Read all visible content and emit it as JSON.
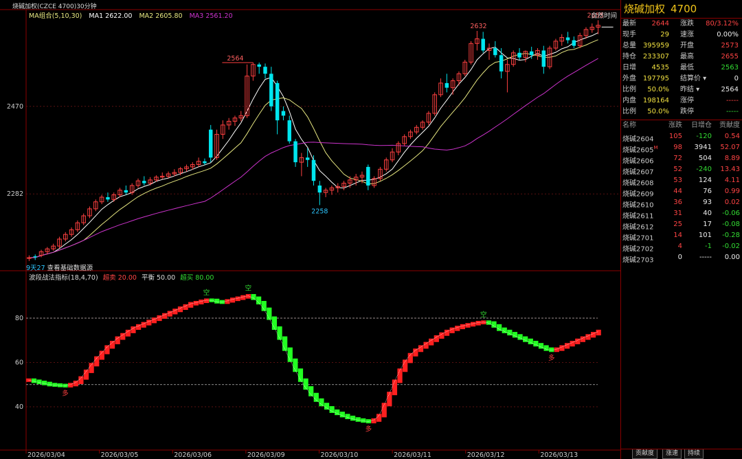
{
  "chart": {
    "title": "烧碱加权(CZCE 4700)30分钟",
    "ma_legend": {
      "label": "MA组合(5,10,30)",
      "ma1": "MA1 2622.00",
      "ma2": "MA2 2605.80",
      "ma3": "MA3 2561.20"
    },
    "natural_time_label": "自然时间",
    "foot_note_prefix": "9天27",
    "foot_note_text": "查看基础数据源",
    "indicator_legend": {
      "name": "波段战法指标(18,4,70)",
      "oversold": "超卖 20.00",
      "balance": "平衡 50.00",
      "overbought": "超买 80.00"
    },
    "marker_up": "空",
    "marker_down": "多",
    "colors": {
      "up": "#ff4040",
      "down": "#00e5ee",
      "ma1": "#ffffff",
      "ma2": "#e6e680",
      "ma3": "#cc33cc",
      "ind_up": "#ff2020",
      "ind_down": "#22ff22"
    }
  },
  "chart_data": [
    {
      "type": "candlestick",
      "title": "烧碱加权(CZCE 4700)30分钟",
      "x_dates": [
        "2026/03/04",
        "2026/03/05",
        "2026/03/06",
        "2026/03/09",
        "2026/03/10",
        "2026/03/11",
        "2026/03/12",
        "2026/03/13"
      ],
      "y_ticks": [
        2470,
        2282
      ],
      "ylim": [
        2120,
        2660
      ],
      "annotations": {
        "high_1": 2564,
        "low_1": 2258,
        "high_2": 2632,
        "high_3": 2655
      },
      "series": [
        {
          "name": "K",
          "values": [
            [
              2145,
              2150,
              2138,
              2145
            ],
            [
              2148,
              2152,
              2140,
              2146
            ],
            [
              2150,
              2162,
              2146,
              2158
            ],
            [
              2158,
              2168,
              2152,
              2164
            ],
            [
              2164,
              2175,
              2160,
              2170
            ],
            [
              2170,
              2190,
              2165,
              2185
            ],
            [
              2185,
              2200,
              2180,
              2195
            ],
            [
              2195,
              2210,
              2190,
              2205
            ],
            [
              2205,
              2225,
              2200,
              2220
            ],
            [
              2220,
              2240,
              2215,
              2235
            ],
            [
              2235,
              2255,
              2230,
              2250
            ],
            [
              2250,
              2270,
              2245,
              2265
            ],
            [
              2265,
              2280,
              2260,
              2275
            ],
            [
              2275,
              2285,
              2265,
              2270
            ],
            [
              2270,
              2285,
              2265,
              2280
            ],
            [
              2280,
              2295,
              2275,
              2290
            ],
            [
              2290,
              2300,
              2280,
              2285
            ],
            [
              2285,
              2305,
              2280,
              2300
            ],
            [
              2300,
              2315,
              2295,
              2310
            ],
            [
              2310,
              2320,
              2300,
              2305
            ],
            [
              2305,
              2318,
              2300,
              2312
            ],
            [
              2312,
              2322,
              2308,
              2318
            ],
            [
              2318,
              2328,
              2314,
              2320
            ],
            [
              2320,
              2330,
              2316,
              2325
            ],
            [
              2325,
              2335,
              2320,
              2328
            ],
            [
              2328,
              2340,
              2322,
              2336
            ],
            [
              2336,
              2345,
              2330,
              2340
            ],
            [
              2340,
              2350,
              2334,
              2345
            ],
            [
              2345,
              2360,
              2340,
              2352
            ],
            [
              2352,
              2358,
              2344,
              2348
            ],
            [
              2420,
              2430,
              2350,
              2360
            ],
            [
              2360,
              2420,
              2355,
              2410
            ],
            [
              2410,
              2440,
              2400,
              2430
            ],
            [
              2430,
              2445,
              2420,
              2438
            ],
            [
              2438,
              2450,
              2428,
              2445
            ],
            [
              2445,
              2460,
              2438,
              2450
            ],
            [
              2450,
              2560,
              2445,
              2535
            ],
            [
              2535,
              2564,
              2525,
              2560
            ],
            [
              2560,
              2564,
              2540,
              2555
            ],
            [
              2555,
              2562,
              2530,
              2540
            ],
            [
              2540,
              2555,
              2460,
              2470
            ],
            [
              2520,
              2525,
              2410,
              2440
            ],
            [
              2460,
              2470,
              2440,
              2450
            ],
            [
              2440,
              2450,
              2390,
              2395
            ],
            [
              2395,
              2400,
              2340,
              2350
            ],
            [
              2350,
              2370,
              2320,
              2360
            ],
            [
              2360,
              2380,
              2340,
              2355
            ],
            [
              2355,
              2365,
              2300,
              2310
            ],
            [
              2300,
              2310,
              2258,
              2285
            ],
            [
              2285,
              2295,
              2275,
              2290
            ],
            [
              2290,
              2300,
              2280,
              2295
            ],
            [
              2295,
              2305,
              2285,
              2298
            ],
            [
              2298,
              2310,
              2290,
              2305
            ],
            [
              2305,
              2320,
              2295,
              2312
            ],
            [
              2312,
              2325,
              2300,
              2318
            ],
            [
              2318,
              2330,
              2305,
              2322
            ],
            [
              2340,
              2345,
              2290,
              2300
            ],
            [
              2300,
              2320,
              2295,
              2315
            ],
            [
              2315,
              2340,
              2310,
              2335
            ],
            [
              2335,
              2360,
              2330,
              2355
            ],
            [
              2355,
              2380,
              2350,
              2372
            ],
            [
              2372,
              2395,
              2365,
              2390
            ],
            [
              2390,
              2410,
              2385,
              2405
            ],
            [
              2405,
              2420,
              2400,
              2415
            ],
            [
              2415,
              2430,
              2410,
              2425
            ],
            [
              2425,
              2440,
              2420,
              2436
            ],
            [
              2436,
              2460,
              2430,
              2455
            ],
            [
              2455,
              2500,
              2450,
              2495
            ],
            [
              2495,
              2530,
              2490,
              2520
            ],
            [
              2520,
              2540,
              2500,
              2510
            ],
            [
              2510,
              2530,
              2495,
              2525
            ],
            [
              2525,
              2545,
              2515,
              2540
            ],
            [
              2540,
              2570,
              2535,
              2565
            ],
            [
              2565,
              2610,
              2560,
              2605
            ],
            [
              2605,
              2632,
              2590,
              2615
            ],
            [
              2615,
              2630,
              2585,
              2590
            ],
            [
              2590,
              2605,
              2570,
              2595
            ],
            [
              2595,
              2610,
              2575,
              2580
            ],
            [
              2580,
              2595,
              2530,
              2545
            ],
            [
              2545,
              2570,
              2500,
              2560
            ],
            [
              2560,
              2590,
              2555,
              2585
            ],
            [
              2585,
              2595,
              2570,
              2575
            ],
            [
              2575,
              2590,
              2565,
              2588
            ],
            [
              2588,
              2598,
              2572,
              2580
            ],
            [
              2580,
              2595,
              2570,
              2590
            ],
            [
              2590,
              2600,
              2540,
              2555
            ],
            [
              2555,
              2600,
              2550,
              2595
            ],
            [
              2595,
              2615,
              2590,
              2610
            ],
            [
              2610,
              2625,
              2600,
              2618
            ],
            [
              2618,
              2630,
              2605,
              2612
            ],
            [
              2612,
              2620,
              2595,
              2600
            ],
            [
              2600,
              2628,
              2595,
              2622
            ],
            [
              2622,
              2640,
              2615,
              2635
            ],
            [
              2635,
              2648,
              2628,
              2640
            ],
            [
              2640,
              2655,
              2625,
              2644
            ]
          ]
        },
        {
          "name": "MA1",
          "values": []
        },
        {
          "name": "MA2",
          "values": []
        },
        {
          "name": "MA3",
          "values": []
        }
      ]
    },
    {
      "type": "bar",
      "title": "波段战法指标(18,4,70)",
      "y_ticks": [
        80,
        60,
        40
      ],
      "ylim": [
        22,
        98
      ],
      "reference_lines": [
        20,
        50,
        80
      ],
      "series": [
        {
          "name": "波段",
          "values": [
            52,
            51.5,
            51,
            50.5,
            50,
            49.8,
            49.6,
            49.5,
            50,
            51,
            53,
            56,
            59,
            62,
            64.5,
            67,
            69,
            71,
            72.5,
            74,
            75.5,
            76.5,
            77.5,
            78.5,
            79.5,
            80.5,
            81.5,
            82.5,
            83.5,
            84.5,
            85.5,
            86.5,
            87,
            87.6,
            88.1,
            88,
            87.4,
            87.2,
            87.8,
            88.5,
            89,
            89.6,
            90.1,
            89,
            87,
            84,
            80,
            75.5,
            71,
            66,
            61,
            56.5,
            52,
            48.5,
            45.5,
            43,
            41,
            39.5,
            38,
            37,
            36,
            35.2,
            34.5,
            34,
            33.6,
            33.3,
            34,
            36,
            41,
            46,
            51.5,
            56.5,
            60.5,
            63.5,
            65.5,
            67,
            68.5,
            70,
            71.5,
            72.8,
            74,
            75,
            75.8,
            76.5,
            77,
            77.5,
            78,
            78.2,
            77.8,
            76.5,
            75,
            74,
            73,
            72,
            71,
            70,
            69,
            68,
            67,
            66,
            65.5,
            66,
            67,
            68,
            69,
            70,
            71,
            72,
            73,
            74
          ]
        }
      ]
    }
  ],
  "quote": {
    "title": "烧碱加权",
    "code": "4700",
    "rows": [
      {
        "l1": "最新",
        "v1": "2644",
        "c1": "red",
        "l2": "涨跌",
        "v2": "80/3.12%",
        "c2": "red"
      },
      {
        "l1": "现手",
        "v1": "29",
        "c1": "yellow",
        "l2": "速涨",
        "v2": "0.00%",
        "c2": "white"
      },
      {
        "l1": "总量",
        "v1": "395959",
        "c1": "yellow",
        "l2": "开盘",
        "v2": "2573",
        "c2": "red"
      },
      {
        "l1": "持仓",
        "v1": "233307",
        "c1": "yellow",
        "l2": "最高",
        "v2": "2655",
        "c2": "red"
      },
      {
        "l1": "日增",
        "v1": "4535",
        "c1": "yellow",
        "l2": "最低",
        "v2": "2563",
        "c2": "green"
      },
      {
        "l1": "外盘",
        "v1": "197795",
        "c1": "yellow",
        "l2": "结算价 ▾",
        "v2": "0",
        "c2": "white"
      },
      {
        "l1": "比例",
        "v1": "50.0%",
        "c1": "yellow",
        "l2": "昨结 ▾",
        "v2": "2564",
        "c2": "white"
      },
      {
        "l1": "内盘",
        "v1": "198164",
        "c1": "yellow",
        "l2": "涨停",
        "v2": "-----",
        "c2": "red"
      },
      {
        "l1": "比例",
        "v1": "50.0%",
        "c1": "yellow",
        "l2": "跌停",
        "v2": "-----",
        "c2": "green"
      }
    ],
    "table_headers": [
      "名称",
      "涨跌",
      "日增仓",
      "贡献度"
    ],
    "table_rows": [
      {
        "name": "烧碱2604",
        "mark": "",
        "chg": "105",
        "oi": "-120",
        "oi_c": "green",
        "ctr": "0.54",
        "ctr_c": "red"
      },
      {
        "name": "烧碱2605",
        "mark": "M",
        "chg": "98",
        "oi": "3941",
        "oi_c": "white",
        "ctr": "52.07",
        "ctr_c": "red"
      },
      {
        "name": "烧碱2606",
        "mark": "",
        "chg": "72",
        "oi": "504",
        "oi_c": "white",
        "ctr": "8.89",
        "ctr_c": "red"
      },
      {
        "name": "烧碱2607",
        "mark": "",
        "chg": "52",
        "oi": "-240",
        "oi_c": "green",
        "ctr": "13.43",
        "ctr_c": "red"
      },
      {
        "name": "烧碱2608",
        "mark": "",
        "chg": "53",
        "oi": "124",
        "oi_c": "white",
        "ctr": "4.11",
        "ctr_c": "red"
      },
      {
        "name": "烧碱2609",
        "mark": "",
        "chg": "44",
        "oi": "76",
        "oi_c": "white",
        "ctr": "0.99",
        "ctr_c": "red"
      },
      {
        "name": "烧碱2610",
        "mark": "",
        "chg": "36",
        "oi": "93",
        "oi_c": "white",
        "ctr": "0.02",
        "ctr_c": "red"
      },
      {
        "name": "烧碱2611",
        "mark": "",
        "chg": "31",
        "oi": "40",
        "oi_c": "white",
        "ctr": "-0.06",
        "ctr_c": "green"
      },
      {
        "name": "烧碱2612",
        "mark": "",
        "chg": "25",
        "oi": "17",
        "oi_c": "white",
        "ctr": "-0.08",
        "ctr_c": "green"
      },
      {
        "name": "烧碱2701",
        "mark": "",
        "chg": "14",
        "oi": "101",
        "oi_c": "white",
        "ctr": "-0.28",
        "ctr_c": "green"
      },
      {
        "name": "烧碱2702",
        "mark": "",
        "chg": "4",
        "oi": "-1",
        "oi_c": "green",
        "ctr": "-0.02",
        "ctr_c": "green"
      },
      {
        "name": "烧碱2703",
        "mark": "",
        "chg": "0",
        "oi": "-----",
        "oi_c": "white",
        "ctr": "0.00",
        "ctr_c": "white"
      }
    ],
    "tabs": [
      "贡献度",
      "涨速",
      "持续"
    ]
  }
}
